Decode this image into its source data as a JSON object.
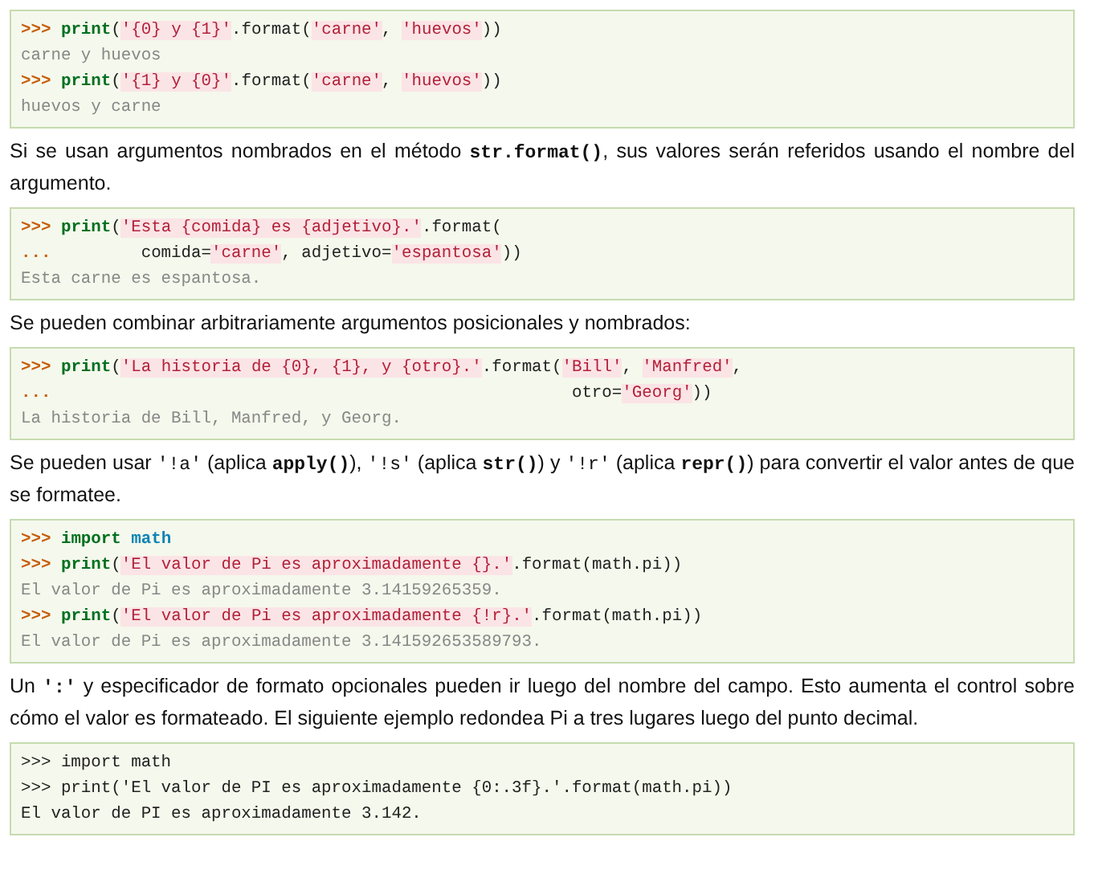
{
  "blocks": [
    {
      "kind": "code",
      "lines": [
        [
          {
            "kind": "prompt",
            "text": ">>> "
          },
          {
            "kind": "keyword",
            "text": "print"
          },
          {
            "kind": "plain",
            "text": "("
          },
          {
            "kind": "string",
            "text": "'{0} y {1}'"
          },
          {
            "kind": "plain",
            "text": ".format("
          },
          {
            "kind": "string",
            "text": "'carne'"
          },
          {
            "kind": "plain",
            "text": ", "
          },
          {
            "kind": "string",
            "text": "'huevos'"
          },
          {
            "kind": "plain",
            "text": "))"
          }
        ],
        [
          {
            "kind": "output",
            "text": "carne y huevos"
          }
        ],
        [
          {
            "kind": "prompt",
            "text": ">>> "
          },
          {
            "kind": "keyword",
            "text": "print"
          },
          {
            "kind": "plain",
            "text": "("
          },
          {
            "kind": "string",
            "text": "'{1} y {0}'"
          },
          {
            "kind": "plain",
            "text": ".format("
          },
          {
            "kind": "string",
            "text": "'carne'"
          },
          {
            "kind": "plain",
            "text": ", "
          },
          {
            "kind": "string",
            "text": "'huevos'"
          },
          {
            "kind": "plain",
            "text": "))"
          }
        ],
        [
          {
            "kind": "output",
            "text": "huevos y carne"
          }
        ]
      ]
    },
    {
      "kind": "paragraph",
      "parts": [
        {
          "kind": "text",
          "text": "Si se usan argumentos nombrados en el método "
        },
        {
          "kind": "code_bold",
          "text": "str.format()"
        },
        {
          "kind": "text",
          "text": ", sus valores serán referidos usando el nombre del argumento."
        }
      ]
    },
    {
      "kind": "code",
      "lines": [
        [
          {
            "kind": "prompt",
            "text": ">>> "
          },
          {
            "kind": "keyword",
            "text": "print"
          },
          {
            "kind": "plain",
            "text": "("
          },
          {
            "kind": "string",
            "text": "'Esta {comida} es {adjetivo}.'"
          },
          {
            "kind": "plain",
            "text": ".format("
          }
        ],
        [
          {
            "kind": "prompt",
            "text": "...         "
          },
          {
            "kind": "plain",
            "text": "comida="
          },
          {
            "kind": "string",
            "text": "'carne'"
          },
          {
            "kind": "plain",
            "text": ", adjetivo="
          },
          {
            "kind": "string",
            "text": "'espantosa'"
          },
          {
            "kind": "plain",
            "text": "))"
          }
        ],
        [
          {
            "kind": "output",
            "text": "Esta carne es espantosa."
          }
        ]
      ]
    },
    {
      "kind": "paragraph",
      "parts": [
        {
          "kind": "text",
          "text": "Se pueden combinar arbitrariamente argumentos posicionales y nombrados:"
        }
      ]
    },
    {
      "kind": "code",
      "lines": [
        [
          {
            "kind": "prompt",
            "text": ">>> "
          },
          {
            "kind": "keyword",
            "text": "print"
          },
          {
            "kind": "plain",
            "text": "("
          },
          {
            "kind": "string",
            "text": "'La historia de {0}, {1}, y {otro}.'"
          },
          {
            "kind": "plain",
            "text": ".format("
          },
          {
            "kind": "string",
            "text": "'Bill'"
          },
          {
            "kind": "plain",
            "text": ", "
          },
          {
            "kind": "string",
            "text": "'Manfred'"
          },
          {
            "kind": "plain",
            "text": ","
          }
        ],
        [
          {
            "kind": "prompt",
            "text": "...                                                    "
          },
          {
            "kind": "plain",
            "text": "otro="
          },
          {
            "kind": "string",
            "text": "'Georg'"
          },
          {
            "kind": "plain",
            "text": "))"
          }
        ],
        [
          {
            "kind": "output",
            "text": "La historia de Bill, Manfred, y Georg."
          }
        ]
      ]
    },
    {
      "kind": "paragraph",
      "parts": [
        {
          "kind": "text",
          "text": "Se pueden usar "
        },
        {
          "kind": "code",
          "text": "'!a'"
        },
        {
          "kind": "text",
          "text": " (aplica "
        },
        {
          "kind": "code_bold",
          "text": "apply()"
        },
        {
          "kind": "text",
          "text": "), "
        },
        {
          "kind": "code",
          "text": "'!s'"
        },
        {
          "kind": "text",
          "text": " (aplica "
        },
        {
          "kind": "code_bold",
          "text": "str()"
        },
        {
          "kind": "text",
          "text": ") y "
        },
        {
          "kind": "code",
          "text": "'!r'"
        },
        {
          "kind": "text",
          "text": " (aplica "
        },
        {
          "kind": "code_bold",
          "text": "repr()"
        },
        {
          "kind": "text",
          "text": ") para convertir el valor antes de que se formatee."
        }
      ]
    },
    {
      "kind": "code",
      "lines": [
        [
          {
            "kind": "prompt",
            "text": ">>> "
          },
          {
            "kind": "keyword",
            "text": "import "
          },
          {
            "kind": "module",
            "text": "math"
          }
        ],
        [
          {
            "kind": "prompt",
            "text": ">>> "
          },
          {
            "kind": "keyword",
            "text": "print"
          },
          {
            "kind": "plain",
            "text": "("
          },
          {
            "kind": "string",
            "text": "'El valor de Pi es aproximadamente {}.'"
          },
          {
            "kind": "plain",
            "text": ".format(math.pi))"
          }
        ],
        [
          {
            "kind": "output",
            "text": "El valor de Pi es aproximadamente 3.14159265359."
          }
        ],
        [
          {
            "kind": "prompt",
            "text": ">>> "
          },
          {
            "kind": "keyword",
            "text": "print"
          },
          {
            "kind": "plain",
            "text": "("
          },
          {
            "kind": "string",
            "text": "'El valor de Pi es aproximadamente {!r}.'"
          },
          {
            "kind": "plain",
            "text": ".format(math.pi))"
          }
        ],
        [
          {
            "kind": "output",
            "text": "El valor de Pi es aproximadamente 3.141592653589793."
          }
        ]
      ]
    },
    {
      "kind": "paragraph",
      "parts": [
        {
          "kind": "text",
          "text": "Un "
        },
        {
          "kind": "code_bold",
          "text": "':'"
        },
        {
          "kind": "text",
          "text": " y especificador de formato opcionales pueden ir luego del nombre del campo. Esto aumenta el control sobre cómo el valor es formateado. El siguiente ejemplo redondea Pi a tres lugares luego del punto decimal."
        }
      ]
    },
    {
      "kind": "code",
      "lines": [
        [
          {
            "kind": "plain",
            "text": ">>> import math"
          }
        ],
        [
          {
            "kind": "plain",
            "text": ">>> print('El valor de PI es aproximadamente {0:.3f}.'.format(math.pi))"
          }
        ],
        [
          {
            "kind": "plain",
            "text": "El valor de PI es aproximadamente 3.142."
          }
        ]
      ]
    }
  ]
}
